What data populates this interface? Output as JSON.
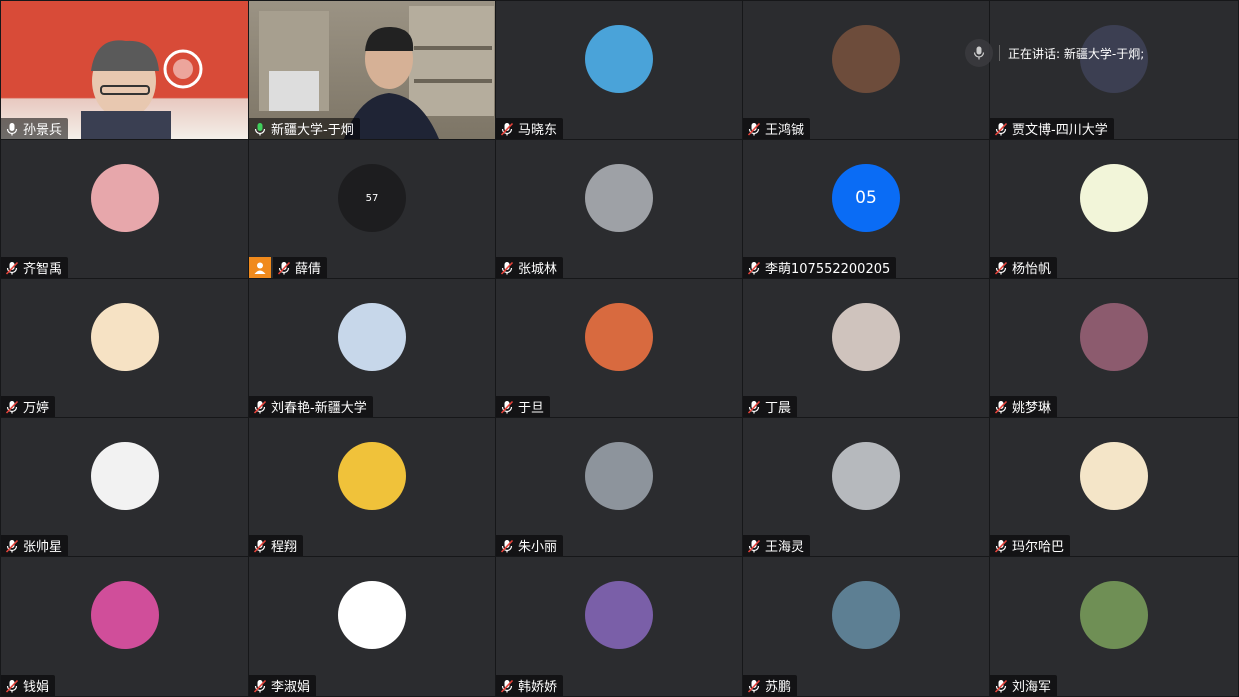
{
  "meeting": {
    "speaking_label": "正在讲话: 新疆大学-于炯;",
    "participants": [
      {
        "name": "孙景兵",
        "mic": "on",
        "video": true,
        "bg": "#d6493a"
      },
      {
        "name": "新疆大学-于炯",
        "mic": "speaking",
        "video": true,
        "bg": "#8e8779"
      },
      {
        "name": "马晓东",
        "mic": "muted",
        "avatar_color": "#4aa3d9"
      },
      {
        "name": "王鸿铖",
        "mic": "muted",
        "avatar_color": "#6d4c3b"
      },
      {
        "name": "贾文博-四川大学",
        "mic": "muted",
        "avatar_color": "#3c3f52"
      },
      {
        "name": "齐智禹",
        "mic": "muted",
        "avatar_color": "#e7a7ab"
      },
      {
        "name": "薛倩",
        "mic": "muted",
        "avatar_color": "#1d1d1f",
        "avatar_text": "57",
        "host": true
      },
      {
        "name": "张城林",
        "mic": "muted",
        "avatar_color": "#9ea1a6"
      },
      {
        "name": "李萌107552200205",
        "mic": "muted",
        "avatar_color": "#0a6cf5",
        "avatar_text": "05"
      },
      {
        "name": "杨怡帆",
        "mic": "muted",
        "avatar_color": "#f2f5d9"
      },
      {
        "name": "万婷",
        "mic": "muted",
        "avatar_color": "#f6e2c4"
      },
      {
        "name": "刘春艳-新疆大学",
        "mic": "muted",
        "avatar_color": "#c7d7ea"
      },
      {
        "name": "于旦",
        "mic": "muted",
        "avatar_color": "#d86a3f"
      },
      {
        "name": "丁晨",
        "mic": "muted",
        "avatar_color": "#cfc3bd"
      },
      {
        "name": "姚梦琳",
        "mic": "muted",
        "avatar_color": "#8c5b6e"
      },
      {
        "name": "张帅星",
        "mic": "muted",
        "avatar_color": "#f2f2f2"
      },
      {
        "name": "程翔",
        "mic": "muted",
        "avatar_color": "#f0c23a"
      },
      {
        "name": "朱小丽",
        "mic": "muted",
        "avatar_color": "#8d949c"
      },
      {
        "name": "王海灵",
        "mic": "muted",
        "avatar_color": "#b6b9bd"
      },
      {
        "name": "玛尔哈巴",
        "mic": "muted",
        "avatar_color": "#f4e5c8"
      },
      {
        "name": "钱娟",
        "mic": "muted",
        "avatar_color": "#d04e9a"
      },
      {
        "name": "李淑娟",
        "mic": "muted",
        "avatar_color": "#ffffff"
      },
      {
        "name": "韩娇娇",
        "mic": "muted",
        "avatar_color": "#7a5fa8"
      },
      {
        "name": "苏鹏",
        "mic": "muted",
        "avatar_color": "#5d7f93"
      },
      {
        "name": "刘海军",
        "mic": "muted",
        "avatar_color": "#6f8f55"
      }
    ]
  }
}
